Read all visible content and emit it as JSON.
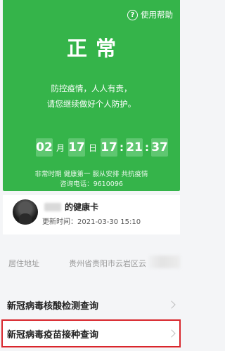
{
  "status_card": {
    "help_label": "使用帮助",
    "help_icon": "question-circle-icon",
    "status": "正常",
    "slogan_line1": "防控疫情，人人有责，",
    "slogan_line2": "请您继续做好个人防护。",
    "datetime": {
      "month": "02",
      "month_unit": "月",
      "day": "17",
      "day_unit": "日",
      "hour": "17",
      "minute": "21",
      "second": "37"
    },
    "footer_line1": "非常时期 健康第一 服从安排 共抗疫情",
    "footer_line2": "咨询电话：9610096",
    "color": "#35b44a"
  },
  "health_card": {
    "title": "的健康卡",
    "updated": "更新时间：2021-03-30 15:10"
  },
  "address": {
    "label": "居住地址",
    "value": "贵州省贵阳市云岩区云"
  },
  "queries": [
    {
      "label": "新冠病毒核酸检测查询"
    },
    {
      "label": "新冠病毒疫苗接种查询"
    }
  ],
  "highlight_color": "#d8262c"
}
